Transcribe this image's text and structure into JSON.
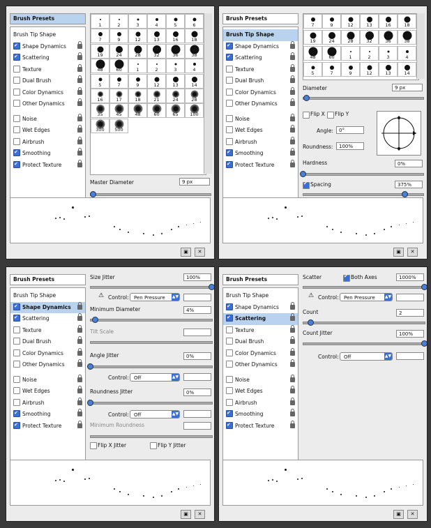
{
  "sidebar": {
    "presets_label": "Brush Presets",
    "tip_shape_label": "Brush Tip Shape",
    "items": [
      {
        "label": "Shape Dynamics"
      },
      {
        "label": "Scattering"
      },
      {
        "label": "Texture"
      },
      {
        "label": "Dual Brush"
      },
      {
        "label": "Color Dynamics"
      },
      {
        "label": "Other Dynamics"
      },
      {
        "label": "Noise"
      },
      {
        "label": "Wet Edges"
      },
      {
        "label": "Airbrush"
      },
      {
        "label": "Smoothing"
      },
      {
        "label": "Protect Texture"
      }
    ]
  },
  "panel1": {
    "presets_grid": [
      "1",
      "2",
      "3",
      "4",
      "5",
      "6",
      "7",
      "9",
      "12",
      "13",
      "16",
      "18",
      "19",
      "24",
      "28",
      "32",
      "36",
      "38",
      "48",
      "60",
      "1",
      "2",
      "3",
      "4",
      "5",
      "7",
      "9",
      "12",
      "13",
      "14",
      "16",
      "17",
      "18",
      "21",
      "24",
      "28",
      "35",
      "45",
      "48",
      "60",
      "65",
      "100",
      "300",
      "500"
    ],
    "master_diameter_label": "Master Diameter",
    "master_diameter_value": "9 px"
  },
  "panel2": {
    "grid": [
      "7",
      "9",
      "12",
      "13",
      "16",
      "18",
      "19",
      "24",
      "28",
      "32",
      "36",
      "38",
      "48",
      "60",
      "1",
      "2",
      "3",
      "4",
      "5",
      "7",
      "9",
      "12",
      "13",
      "14"
    ],
    "diameter_label": "Diameter",
    "diameter_value": "9 px",
    "flip_x": "Flip X",
    "flip_y": "Flip Y",
    "angle_label": "Angle:",
    "angle_value": "0°",
    "roundness_label": "Roundness:",
    "roundness_value": "100%",
    "hardness_label": "Hardness",
    "hardness_value": "0%",
    "spacing_label": "Spacing",
    "spacing_value": "375%"
  },
  "panel3": {
    "size_jitter_label": "Size Jitter",
    "size_jitter_value": "100%",
    "control_label": "Control:",
    "control_pen": "Pen Pressure",
    "min_diameter_label": "Minimum Diameter",
    "min_diameter_value": "4%",
    "tilt_scale_label": "Tilt Scale",
    "angle_jitter_label": "Angle Jitter",
    "angle_jitter_value": "0%",
    "control_off": "Off",
    "roundness_jitter_label": "Roundness Jitter",
    "roundness_jitter_value": "0%",
    "min_roundness_label": "Minimum Roundness",
    "flip_x_jitter": "Flip X Jitter",
    "flip_y_jitter": "Flip Y Jitter"
  },
  "panel4": {
    "scatter_label": "Scatter",
    "both_axes_label": "Both Axes",
    "scatter_value": "1000%",
    "control_label": "Control:",
    "control_pen": "Pen Pressure",
    "count_label": "Count",
    "count_value": "2",
    "count_jitter_label": "Count Jitter",
    "count_jitter_value": "100%",
    "control_off": "Off"
  }
}
